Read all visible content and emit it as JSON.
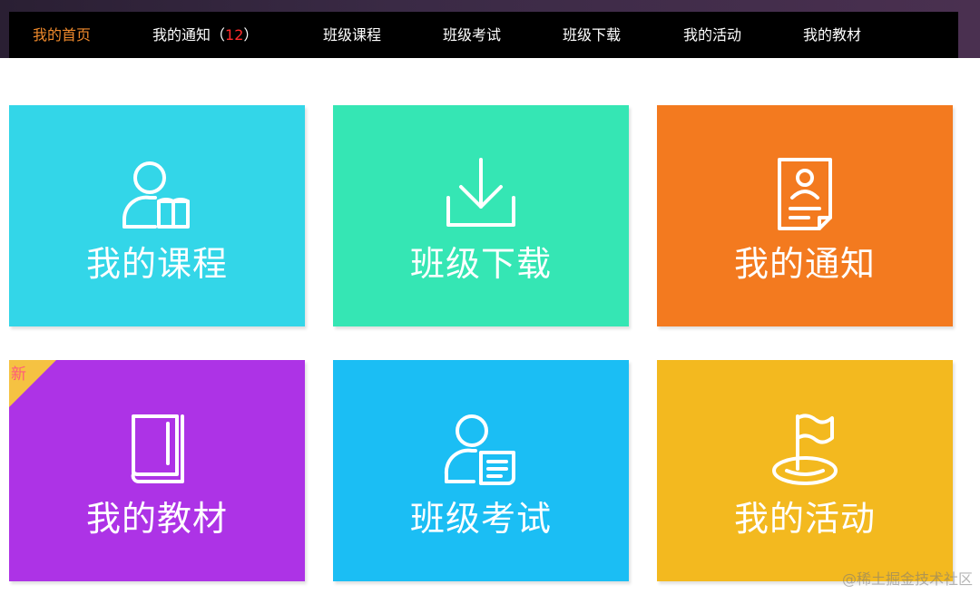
{
  "nav": {
    "home": "我的首页",
    "notice_prefix": "我的通知（",
    "notice_count": "12",
    "notice_suffix": "）",
    "course": "班级课程",
    "exam": "班级考试",
    "download": "班级下载",
    "activity": "我的活动",
    "textbook": "我的教材"
  },
  "tiles": [
    {
      "label": "我的课程",
      "color": "#33d6e8",
      "icon": "user-book-icon"
    },
    {
      "label": "班级下载",
      "color": "#35e6b4",
      "icon": "download-icon"
    },
    {
      "label": "我的通知",
      "color": "#f37a1f",
      "icon": "notice-document-icon"
    },
    {
      "label": "我的教材",
      "color": "#ad33e6",
      "icon": "book-icon",
      "badge": "新"
    },
    {
      "label": "班级考试",
      "color": "#1bbef4",
      "icon": "user-exam-icon"
    },
    {
      "label": "我的活动",
      "color": "#f3b91f",
      "icon": "flag-icon"
    }
  ],
  "colors": {
    "nav_active": "#f08a2c",
    "nav_count": "#ff2a2a",
    "badge_bg": "#f5c242",
    "badge_text": "#ff5a7a"
  },
  "watermark": "@稀土掘金技术社区"
}
